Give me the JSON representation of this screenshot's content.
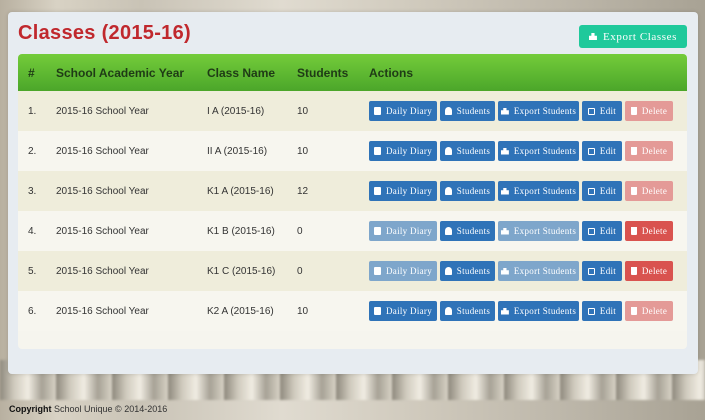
{
  "header": {
    "title": "Classes (2015-16)",
    "export_label": "Export Classes"
  },
  "table": {
    "columns": [
      "#",
      "School Academic Year",
      "Class Name",
      "Students",
      "Actions"
    ],
    "rows": [
      {
        "num": "1.",
        "year": "2015-16 School Year",
        "class_name": "I A (2015-16)",
        "students": "10",
        "diary_enabled": true,
        "export_enabled": true,
        "delete_enabled": false
      },
      {
        "num": "2.",
        "year": "2015-16 School Year",
        "class_name": "II A (2015-16)",
        "students": "10",
        "diary_enabled": true,
        "export_enabled": true,
        "delete_enabled": false
      },
      {
        "num": "3.",
        "year": "2015-16 School Year",
        "class_name": "K1 A (2015-16)",
        "students": "12",
        "diary_enabled": true,
        "export_enabled": true,
        "delete_enabled": false
      },
      {
        "num": "4.",
        "year": "2015-16 School Year",
        "class_name": "K1 B (2015-16)",
        "students": "0",
        "diary_enabled": false,
        "export_enabled": false,
        "delete_enabled": true
      },
      {
        "num": "5.",
        "year": "2015-16 School Year",
        "class_name": "K1 C (2015-16)",
        "students": "0",
        "diary_enabled": false,
        "export_enabled": false,
        "delete_enabled": true
      },
      {
        "num": "6.",
        "year": "2015-16 School Year",
        "class_name": "K2 A (2015-16)",
        "students": "10",
        "diary_enabled": true,
        "export_enabled": true,
        "delete_enabled": false
      }
    ],
    "actions": {
      "diary": "Daily Diary",
      "students": "Students",
      "export_students": "Export Students",
      "edit": "Edit",
      "delete": "Delete"
    }
  },
  "footer": {
    "copyright_label": "Copyright",
    "copyright_text": "School Unique © 2014-2016"
  },
  "colors": {
    "title": "#c0282d",
    "header_green": "#5cb532",
    "export_button": "#1fc99b",
    "action_blue": "#2f73b8",
    "action_red": "#d9534f"
  }
}
